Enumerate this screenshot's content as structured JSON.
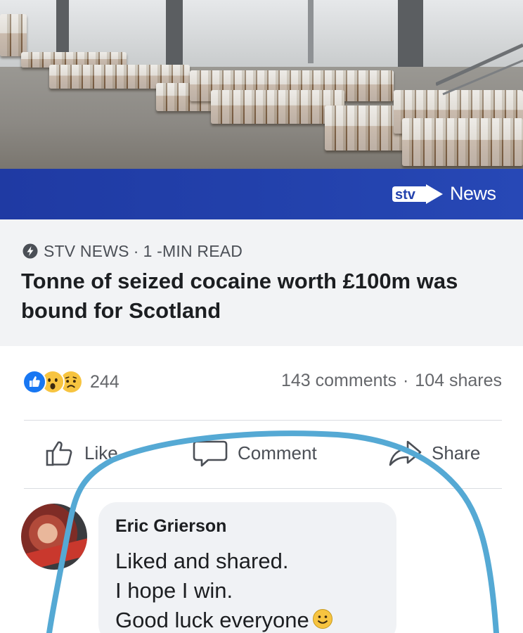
{
  "banner": {
    "logo_text": "stv",
    "news_label": "News"
  },
  "link_preview": {
    "source": "STV NEWS",
    "separator": "·",
    "read_time": "1 -MIN READ",
    "headline": "Tonne of seized cocaine worth £100m was bound for Scotland"
  },
  "engagement": {
    "reactions": [
      "like-icon",
      "wow-icon",
      "sad-icon"
    ],
    "reaction_count": "244",
    "comments": "143 comments",
    "shares": "104 shares",
    "separator": "·"
  },
  "actions": {
    "like": "Like",
    "comment": "Comment",
    "share": "Share"
  },
  "comment": {
    "author": "Eric Grierson",
    "lines": [
      "Liked and shared.",
      "I hope I win.",
      "Good luck everyone"
    ],
    "emoji": "smile-emoji"
  },
  "colors": {
    "banner_blue": "#2342ad",
    "scribble_blue": "#55a9d4",
    "like_blue": "#1877f2",
    "reaction_yellow": "#f7c440"
  }
}
